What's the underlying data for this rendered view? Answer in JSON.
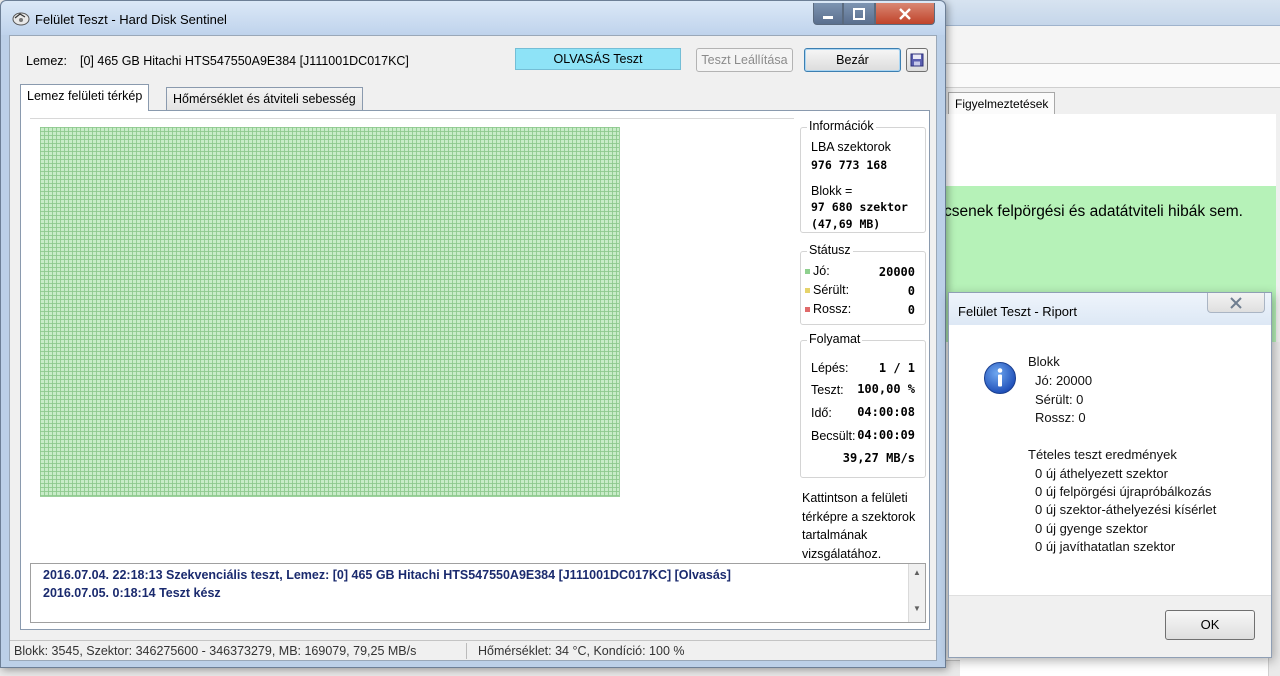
{
  "background": {
    "tab_label": "Figyelmeztetések",
    "message": "csenek felpörgési és adatátviteli hibák sem."
  },
  "window": {
    "title": "Felület Teszt - Hard Disk Sentinel"
  },
  "header": {
    "disk_label": "Lemez:",
    "disk_value": "[0] 465 GB  Hitachi HTS547550A9E384 [J111001DC017KC]",
    "test_badge": "OLVASÁS Teszt",
    "stop_button": "Teszt Leállítása",
    "close_button": "Bezár"
  },
  "tabs": [
    {
      "label": "Lemez felületi térkép",
      "active": true
    },
    {
      "label": "Hőmérséklet és átviteli sebesség",
      "active": false
    }
  ],
  "info": {
    "title": "Információk",
    "lba_label": "LBA szektorok",
    "lba_value": "976 773 168",
    "block_label": "Blokk =",
    "block_sectors": "97 680 szektor",
    "block_size": "(47,69 MB)"
  },
  "status": {
    "title": "Státusz",
    "good_label": "Jó:",
    "good_value": "20000",
    "damaged_label": "Sérült:",
    "damaged_value": "0",
    "bad_label": "Rossz:",
    "bad_value": "0",
    "colors": {
      "good": "#8ed08e",
      "damaged": "#e6d36a",
      "bad": "#e06a6a"
    }
  },
  "progress": {
    "title": "Folyamat",
    "step_label": "Lépés:",
    "step_value": "1 / 1",
    "test_label": "Teszt:",
    "test_value": "100,00 %",
    "time_label": "Idő:",
    "time_value": "04:00:08",
    "est_label": "Becsült:",
    "est_value": "04:00:09",
    "speed": "39,27 MB/s"
  },
  "hint": "Kattintson a felületi térképre a szektorok tartalmának vizsgálatához.",
  "log": [
    "2016.07.04.  22:18:13   Szekvenciális teszt, Lemez: [0] 465 GB  Hitachi HTS547550A9E384 [J111001DC017KC] [Olvasás]",
    "2016.07.05.  0:18:14   Teszt kész"
  ],
  "statusbar": {
    "left": "Blokk: 3545, Szektor: 346275600 - 346373279, MB: 169079, 79,25 MB/s",
    "right": "Hőmérséklet: 34  °C,  Kondíció: 100 %"
  },
  "dialog": {
    "title": "Felület Teszt - Riport",
    "block_heading": "Blokk",
    "good": "Jó: 20000",
    "damaged": "Sérült: 0",
    "bad": "Rossz: 0",
    "results_heading": "Tételes teszt eredmények",
    "results": [
      "0 új áthelyezett szektor",
      "0 új felpörgési újrapróbálkozás",
      "0 új szektor-áthelyezési kísérlet",
      "0 új gyenge szektor",
      "0 új javíthatatlan szektor"
    ],
    "ok_button": "OK"
  }
}
